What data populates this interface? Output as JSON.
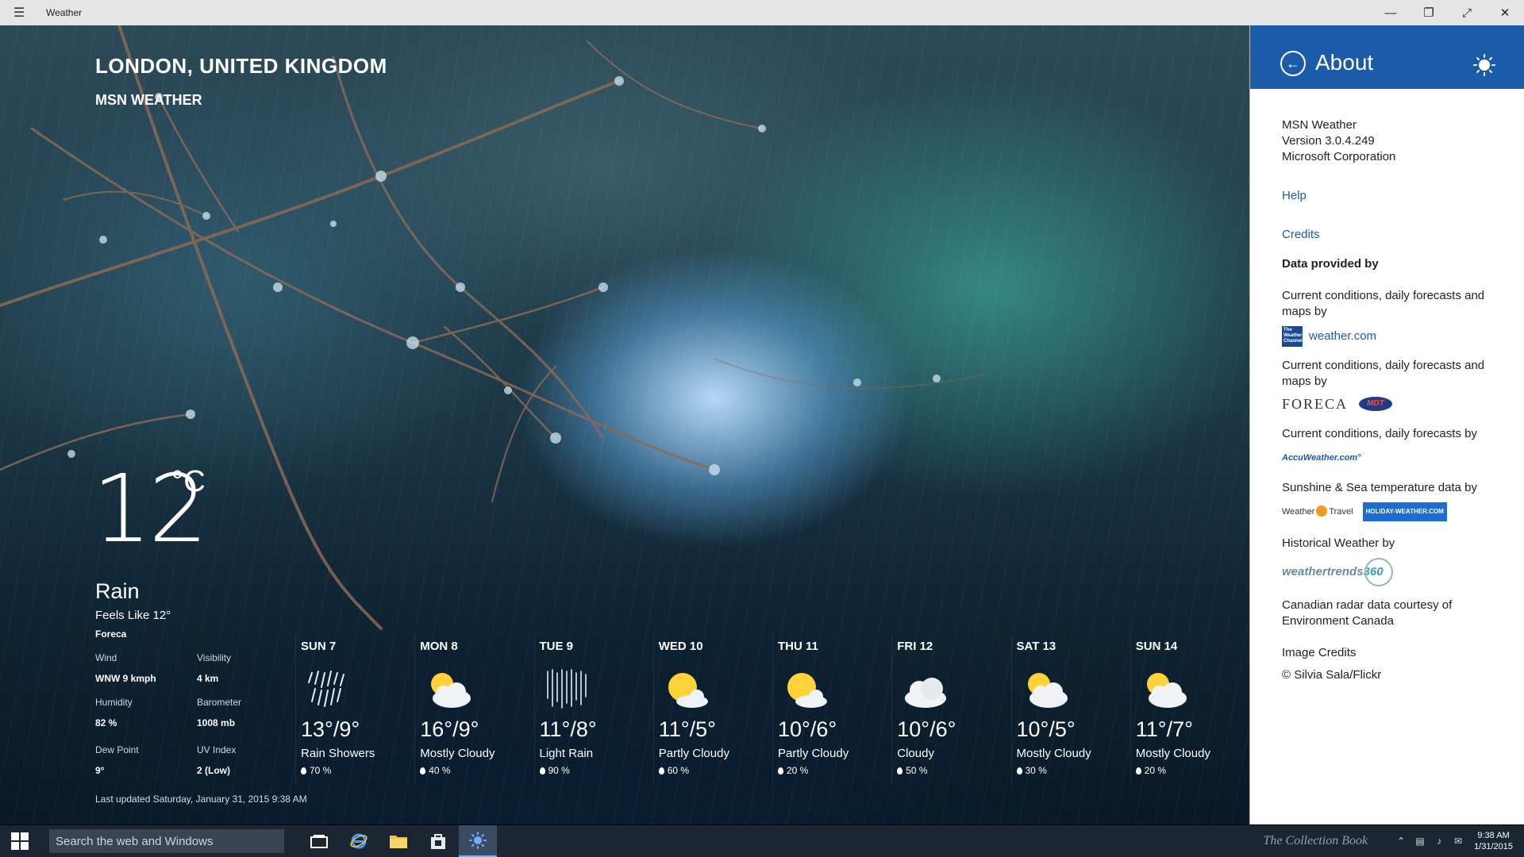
{
  "window": {
    "title": "Weather"
  },
  "location": {
    "city": "LONDON, UNITED KINGDOM",
    "brand": "MSN WEATHER"
  },
  "current": {
    "temp": "12",
    "unit": "°C",
    "condition": "Rain",
    "feels_like": "Feels Like 12°",
    "source": "Foreca",
    "details": [
      {
        "label": "Wind",
        "value": "WNW 9 kmph"
      },
      {
        "label": "Visibility",
        "value": "4 km"
      },
      {
        "label": "Humidity",
        "value": "82 %"
      },
      {
        "label": "Barometer",
        "value": "1008 mb"
      },
      {
        "label": "Dew Point",
        "value": "9°"
      },
      {
        "label": "UV Index",
        "value": "2 (Low)"
      }
    ]
  },
  "forecast": [
    {
      "day": "SUN 7",
      "temp": "13°/9°",
      "condition": "Rain Showers",
      "precip": "70 %",
      "icon": "rain-showers-icon"
    },
    {
      "day": "MON 8",
      "temp": "16°/9°",
      "condition": "Mostly Cloudy",
      "precip": "40 %",
      "icon": "mostly-cloudy-icon"
    },
    {
      "day": "TUE 9",
      "temp": "11°/8°",
      "condition": "Light Rain",
      "precip": "90 %",
      "icon": "light-rain-icon"
    },
    {
      "day": "WED 10",
      "temp": "11°/5°",
      "condition": "Partly Cloudy",
      "precip": "60 %",
      "icon": "partly-cloudy-icon"
    },
    {
      "day": "THU 11",
      "temp": "10°/6°",
      "condition": "Partly Cloudy",
      "precip": "20 %",
      "icon": "partly-cloudy-icon"
    },
    {
      "day": "FRI 12",
      "temp": "10°/6°",
      "condition": "Cloudy",
      "precip": "50 %",
      "icon": "cloudy-icon"
    },
    {
      "day": "SAT 13",
      "temp": "10°/5°",
      "condition": "Mostly Cloudy",
      "precip": "30 %",
      "icon": "mostly-cloudy-icon"
    },
    {
      "day": "SUN 14",
      "temp": "11°/7°",
      "condition": "Mostly Cloudy",
      "precip": "20 %",
      "icon": "mostly-cloudy-icon"
    }
  ],
  "last_updated": "Last updated Saturday, January 31, 2015 9:38 AM",
  "about": {
    "title": "About",
    "app_name": "MSN Weather",
    "version": "Version 3.0.4.249",
    "company": "Microsoft Corporation",
    "help": "Help",
    "credits": "Credits",
    "data_heading": "Data provided by",
    "provider1_text": "Current conditions, daily forecasts and maps by",
    "provider1_link": "weather.com",
    "provider1_logo": "The Weather Channel",
    "provider2_text": "Current conditions, daily forecasts and maps by",
    "provider2_logo": "FORECA",
    "provider2_logo2": "MDT",
    "provider3_text": "Current conditions, daily forecasts by",
    "provider3_logo": "AccuWeather.com°",
    "provider4_text": "Sunshine & Sea temperature data by",
    "provider4_logo_a": "Weather",
    "provider4_logo_b": "Travel",
    "provider4_logo2": "HOLIDAY-WEATHER.COM",
    "provider5_text": "Historical Weather by",
    "provider5_logo_a": "weathertrends",
    "provider5_logo_b": "360",
    "provider6_text": "Canadian radar data courtesy of Environment Canada",
    "image_credits": "Image Credits",
    "image_author": "© Silvia Sala/Flickr"
  },
  "taskbar": {
    "search_placeholder": "Search the web and Windows",
    "watermark": "The Collection Book",
    "time": "9:38 AM",
    "date": "1/31/2015"
  },
  "colors": {
    "accent": "#1c5ba8",
    "taskbar": "#1c2633",
    "titlebar": "#e6e6e6"
  }
}
